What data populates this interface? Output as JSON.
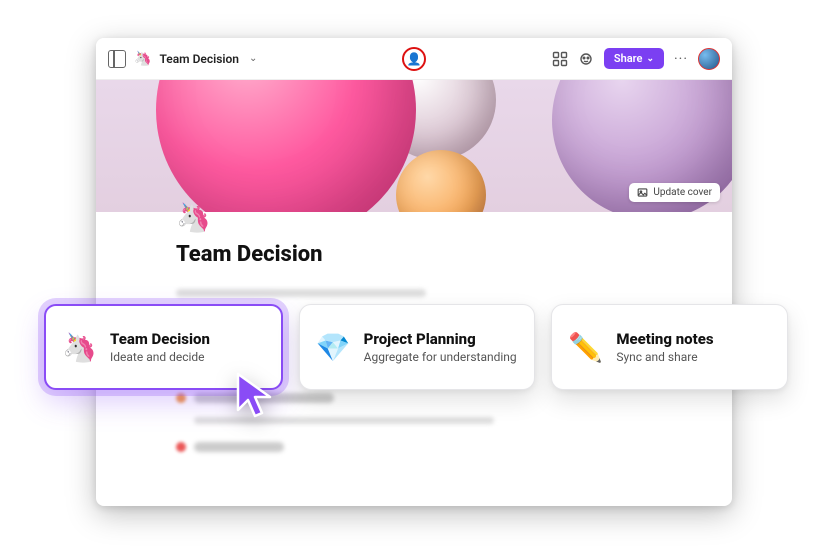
{
  "colors": {
    "accent": "#7b3ff2"
  },
  "topbar": {
    "breadcrumb_emoji": "🦄",
    "breadcrumb_title": "Team Decision",
    "share_label": "Share"
  },
  "cover": {
    "update_cover_label": "Update cover"
  },
  "page": {
    "emoji": "🦄",
    "title": "Team Decision"
  },
  "cards": [
    {
      "emoji": "🦄",
      "title": "Team Decision",
      "subtitle": "Ideate and decide",
      "selected": true
    },
    {
      "emoji": "💎",
      "title": "Project Planning",
      "subtitle": "Aggregate for understanding",
      "selected": false
    },
    {
      "emoji": "✏️",
      "title": "Meeting notes",
      "subtitle": "Sync and share",
      "selected": false
    }
  ]
}
